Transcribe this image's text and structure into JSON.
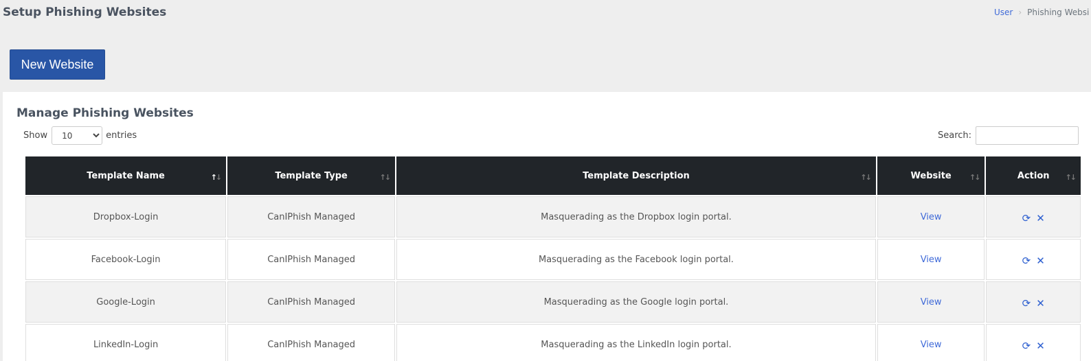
{
  "header": {
    "title": "Setup Phishing Websites",
    "breadcrumb": {
      "user": "User",
      "current": "Phishing Websi"
    }
  },
  "actions": {
    "new_website": "New Website"
  },
  "card": {
    "title": "Manage Phishing Websites",
    "show_label": "Show",
    "entries_value": "10",
    "entries_label": "entries",
    "search_label": "Search:",
    "search_value": ""
  },
  "table": {
    "columns": [
      "Template Name",
      "Template Type",
      "Template Description",
      "Website",
      "Action"
    ],
    "rows": [
      {
        "name": "Dropbox-Login",
        "type": "CanIPhish Managed",
        "description": "Masquerading as the Dropbox login portal.",
        "website": "View"
      },
      {
        "name": "Facebook-Login",
        "type": "CanIPhish Managed",
        "description": "Masquerading as the Facebook login portal.",
        "website": "View"
      },
      {
        "name": "Google-Login",
        "type": "CanIPhish Managed",
        "description": "Masquerading as the Google login portal.",
        "website": "View"
      },
      {
        "name": "LinkedIn-Login",
        "type": "CanIPhish Managed",
        "description": "Masquerading as the LinkedIn login portal.",
        "website": "View"
      }
    ]
  },
  "icons": {
    "refresh": "refresh-icon",
    "delete": "close-icon",
    "sort": "sort-icon"
  },
  "colors": {
    "primary_button": "#2956a6",
    "link": "#3f6ad8",
    "table_header": "#212529"
  }
}
